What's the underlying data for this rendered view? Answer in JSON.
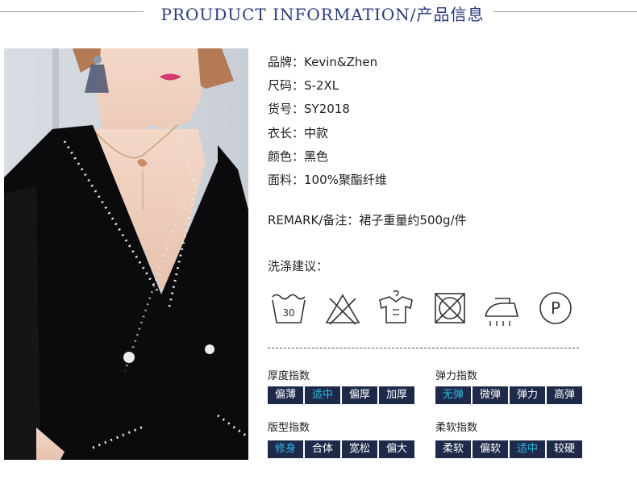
{
  "header": {
    "title": "PROUDUCT INFORMATION/产品信息"
  },
  "info": [
    {
      "label": "品牌：",
      "value": "Kevin&Zhen"
    },
    {
      "label": "尺码：",
      "value": "S-2XL"
    },
    {
      "label": "货号：",
      "value": "SY2018"
    },
    {
      "label": "衣长：",
      "value": "中款"
    },
    {
      "label": "颜色：",
      "value": "黑色"
    },
    {
      "label": "面料：",
      "value": "100%聚酯纤维"
    }
  ],
  "remark": {
    "label": "REMARK/备注：",
    "value": "裙子重量约500g/件"
  },
  "care": {
    "title": "洗涤建议：",
    "wash_temp": "30",
    "dryclean_letter": "P",
    "icons": [
      "wash-30-icon",
      "no-bleach-icon",
      "hang-dry-icon",
      "no-tumble-dry-icon",
      "iron-low-icon",
      "dry-clean-p-icon"
    ]
  },
  "indexes": {
    "thickness": {
      "title": "厚度指数",
      "options": [
        "偏薄",
        "适中",
        "偏厚",
        "加厚"
      ],
      "selected": 1
    },
    "elasticity": {
      "title": "弹力指数",
      "options": [
        "无弹",
        "微弹",
        "弹力",
        "高弹"
      ],
      "selected": 0
    },
    "fit": {
      "title": "版型指数",
      "options": [
        "修身",
        "合体",
        "宽松",
        "偏大"
      ],
      "selected": 0
    },
    "softness": {
      "title": "柔软指数",
      "options": [
        "柔软",
        "偏软",
        "适中",
        "较硬"
      ],
      "selected": 2
    }
  },
  "colors": {
    "navy": "#1f2a4a",
    "highlight": "#2fb9e6",
    "title": "#2a3a7a"
  }
}
